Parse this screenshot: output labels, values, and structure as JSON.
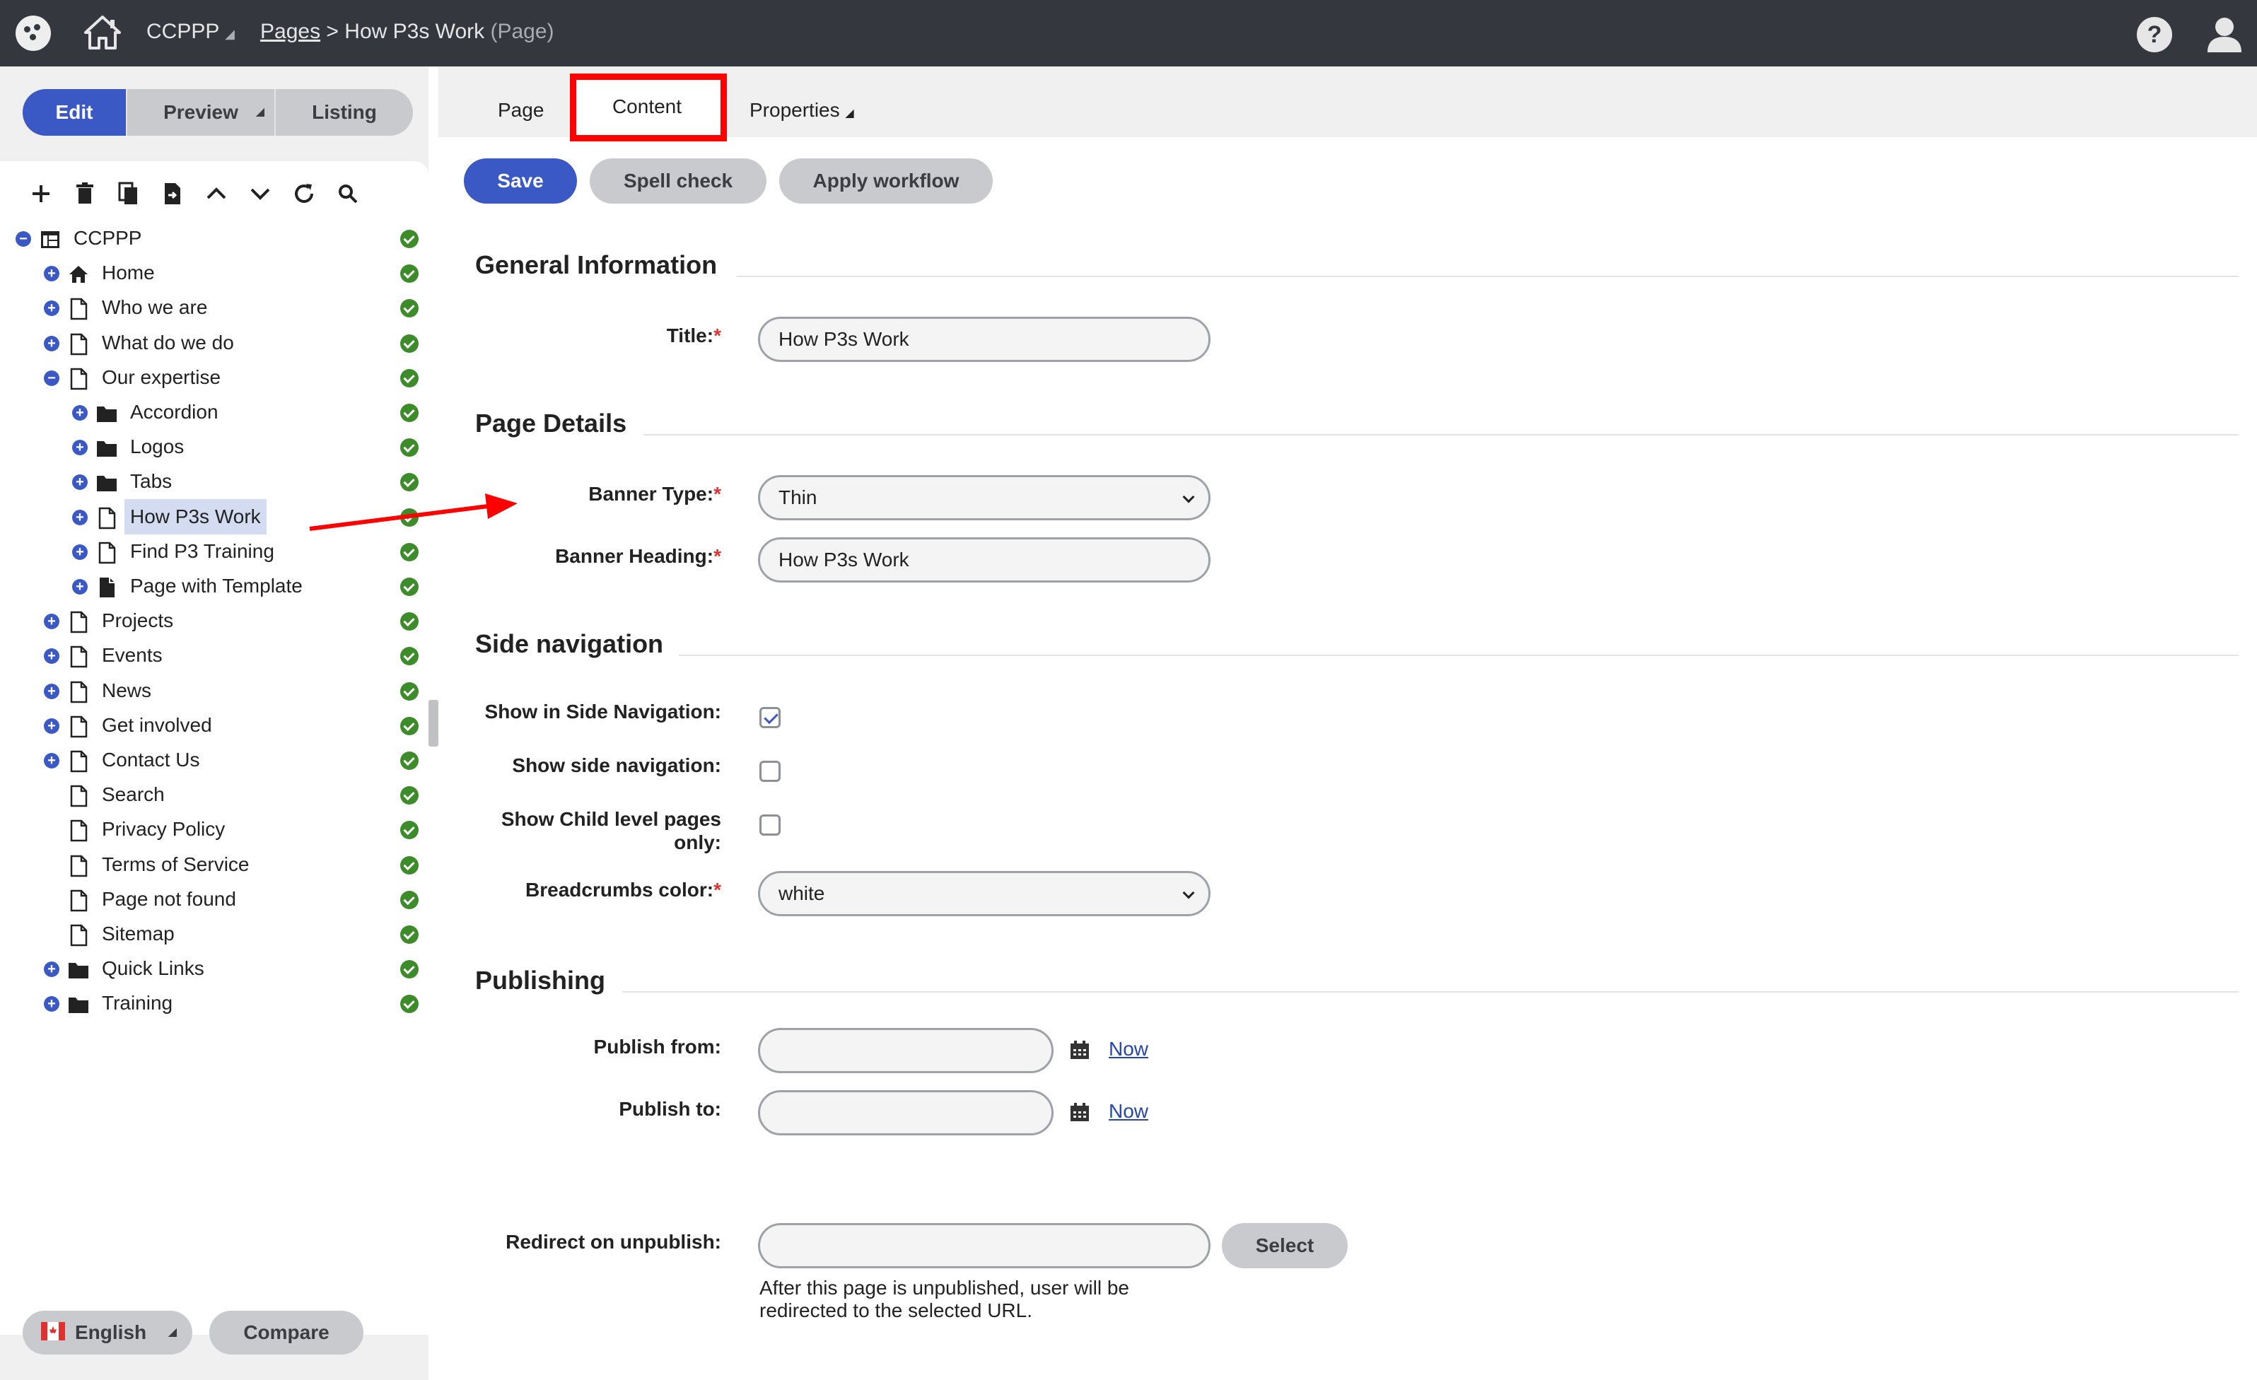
{
  "topbar": {
    "site": "CCPPP",
    "breadcrumb_link": "Pages",
    "breadcrumb_separator": ">",
    "breadcrumb_current": "How P3s Work",
    "breadcrumb_type": "(Page)",
    "help_glyph": "?"
  },
  "modes": {
    "edit": "Edit",
    "preview": "Preview",
    "listing": "Listing"
  },
  "tree": {
    "items": [
      {
        "label": "CCPPP",
        "icon": "site-icon"
      },
      {
        "label": "Home",
        "icon": "home-icon"
      },
      {
        "label": "Who we are",
        "icon": "page-icon"
      },
      {
        "label": "What do we do",
        "icon": "page-icon"
      },
      {
        "label": "Our expertise",
        "icon": "page-icon"
      },
      {
        "label": "Accordion",
        "icon": "folder-icon"
      },
      {
        "label": "Logos",
        "icon": "folder-icon"
      },
      {
        "label": "Tabs",
        "icon": "folder-icon"
      },
      {
        "label": "How P3s Work",
        "icon": "page-icon"
      },
      {
        "label": "Find P3 Training",
        "icon": "page-icon"
      },
      {
        "label": "Page with Template",
        "icon": "template-page-icon"
      },
      {
        "label": "Projects",
        "icon": "page-icon"
      },
      {
        "label": "Events",
        "icon": "page-icon"
      },
      {
        "label": "News",
        "icon": "page-icon"
      },
      {
        "label": "Get involved",
        "icon": "page-icon"
      },
      {
        "label": "Contact Us",
        "icon": "page-icon"
      },
      {
        "label": "Search",
        "icon": "page-icon"
      },
      {
        "label": "Privacy Policy",
        "icon": "page-icon"
      },
      {
        "label": "Terms of Service",
        "icon": "page-icon"
      },
      {
        "label": "Page not found",
        "icon": "page-icon"
      },
      {
        "label": "Sitemap",
        "icon": "page-icon"
      },
      {
        "label": "Quick Links",
        "icon": "folder-icon"
      },
      {
        "label": "Training",
        "icon": "folder-icon"
      }
    ]
  },
  "bottom": {
    "language": "English",
    "compare": "Compare"
  },
  "tabs": {
    "page": "Page",
    "content": "Content",
    "properties": "Properties"
  },
  "actions": {
    "save": "Save",
    "spell_check": "Spell check",
    "apply_workflow": "Apply workflow"
  },
  "sections": {
    "general": "General Information",
    "page_details": "Page Details",
    "side_nav": "Side navigation",
    "publishing": "Publishing"
  },
  "fields": {
    "title_label": "Title:",
    "title_value": "How P3s Work",
    "banner_type_label": "Banner Type:",
    "banner_type_value": "Thin",
    "banner_heading_label": "Banner Heading:",
    "banner_heading_value": "How P3s Work",
    "show_in_side_nav_label": "Show in Side Navigation:",
    "show_side_nav_label": "Show side navigation:",
    "show_child_label_1": "Show Child level pages",
    "show_child_label_2": "only:",
    "breadcrumbs_color_label": "Breadcrumbs color:",
    "breadcrumbs_color_value": "white",
    "publish_from_label": "Publish from:",
    "publish_to_label": "Publish to:",
    "now_link": "Now",
    "redirect_label": "Redirect on unpublish:",
    "select_button": "Select",
    "redirect_help_1": "After this page is unpublished, user will be",
    "redirect_help_2": "redirected to the selected URL.",
    "required_mark": "*"
  },
  "colors": {
    "accent": "#3b59c4",
    "topbar": "#34373d",
    "ok": "#3c8c2a",
    "annotation": "#ff0000"
  }
}
